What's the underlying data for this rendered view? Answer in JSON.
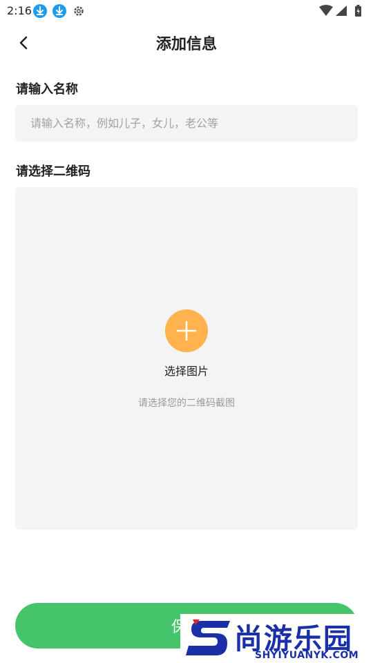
{
  "status_bar": {
    "time": "2:16",
    "icons": [
      "download-icon",
      "download-icon",
      "gear-icon",
      "wifi-icon",
      "signal-icon",
      "battery-icon"
    ]
  },
  "header": {
    "title": "添加信息"
  },
  "form": {
    "name_label": "请输入名称",
    "name_value": "",
    "name_placeholder": "请输入名称，例如儿子，女儿，老公等",
    "qr_label": "请选择二维码",
    "upload_label": "选择图片",
    "upload_hint": "请选择您的二维码截图"
  },
  "save_button": {
    "label": "保存"
  },
  "watermark": {
    "text": "尚游乐园",
    "domain": "SHYIYUANYK.COM"
  },
  "colors": {
    "accent_orange": "#ffb24d",
    "save_green": "#45c46c",
    "input_bg": "#f4f4f4",
    "status_blue": "#1e9bea"
  }
}
